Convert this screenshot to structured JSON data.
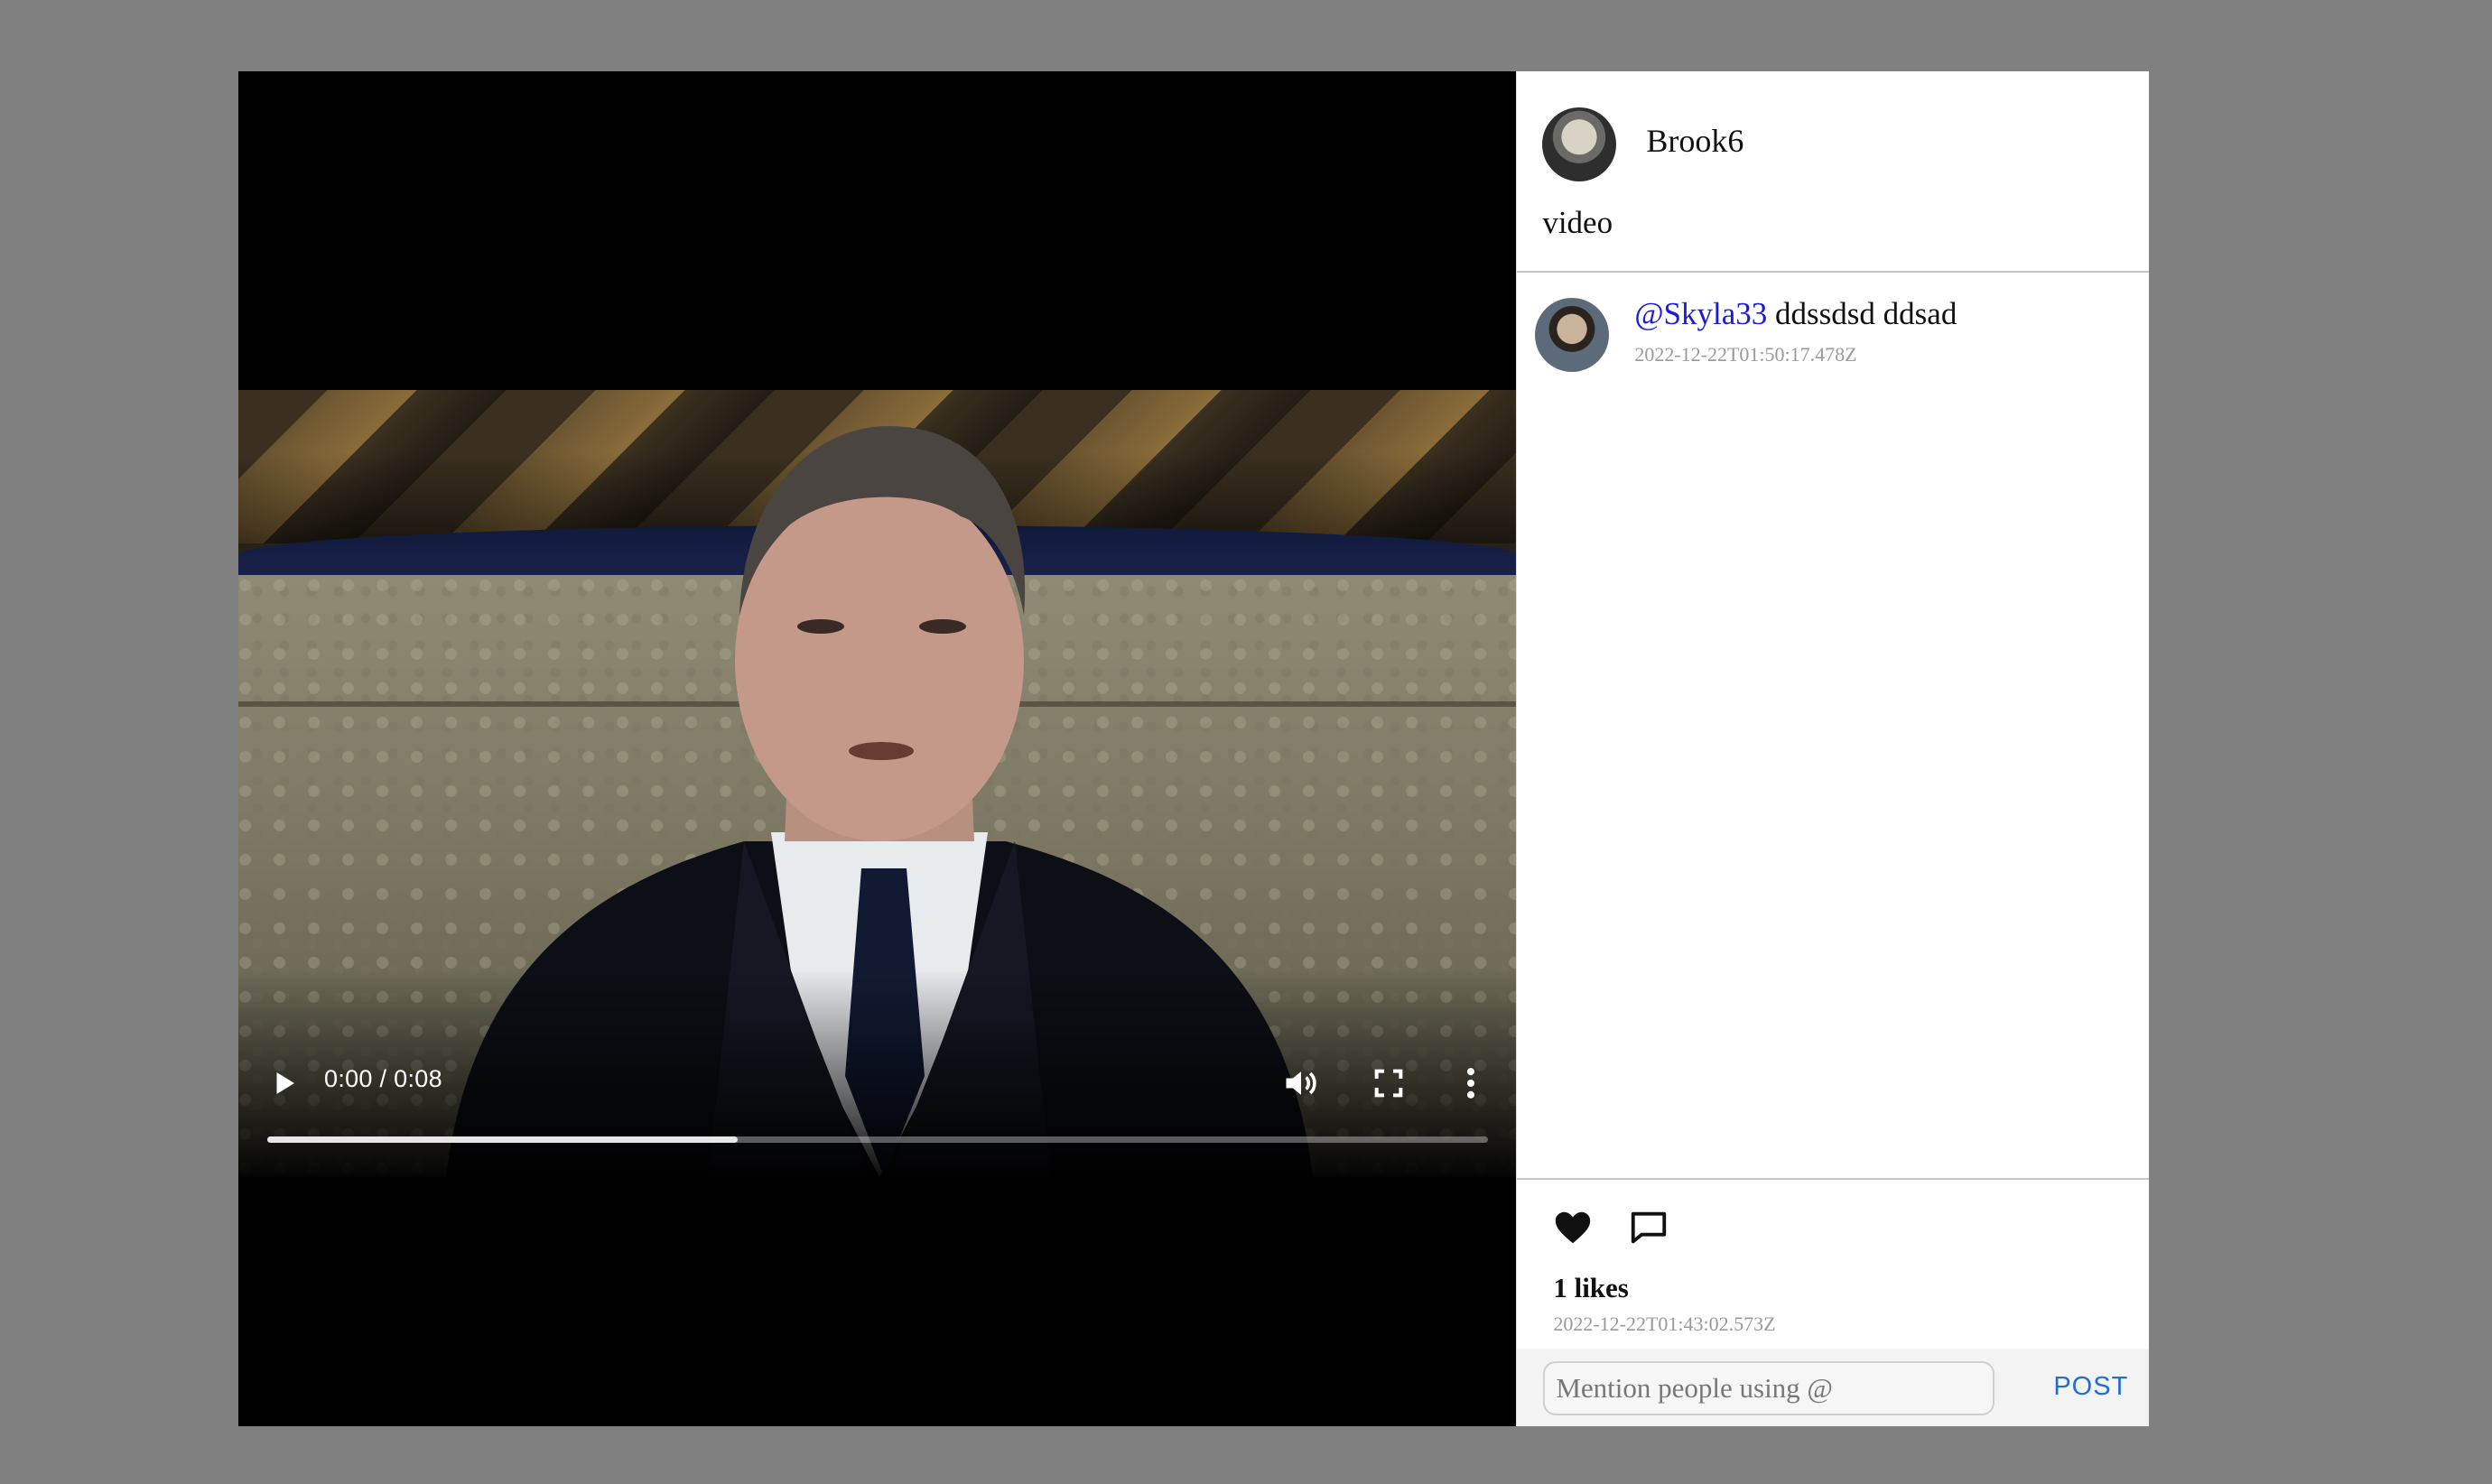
{
  "post": {
    "author": "Brook6",
    "caption": "video",
    "likes_text": "1 likes",
    "timestamp": "2022-12-22T01:43:02.573Z"
  },
  "video": {
    "time_display": "0:00 / 0:08",
    "progress_fraction": 0.385
  },
  "comments": [
    {
      "mention": "@Skyla33",
      "text": " ddssdsd ddsad",
      "timestamp": "2022-12-22T01:50:17.478Z"
    }
  ],
  "composer": {
    "placeholder": "Mention people using @",
    "post_label": "POST"
  },
  "colors": {
    "mention": "#1b1bd8",
    "post_button": "#1d6fd8",
    "overlay": "#808080"
  },
  "icons": [
    "play-icon",
    "volume-icon",
    "fullscreen-icon",
    "more-vert-icon",
    "heart-icon",
    "comment-icon"
  ]
}
